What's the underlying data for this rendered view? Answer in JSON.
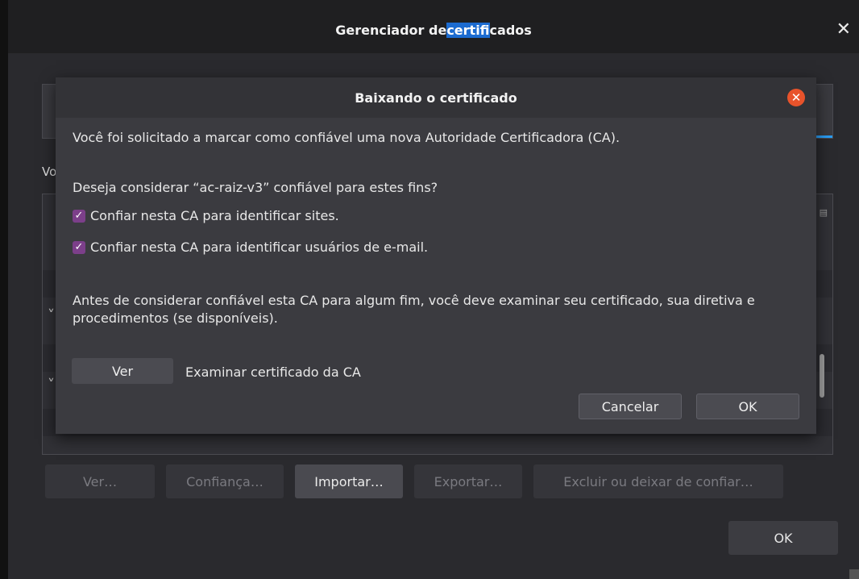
{
  "background_window": {
    "title_prefix": "Gerenciador de ",
    "title_highlight": "certifi",
    "title_suffix": "cados",
    "close_glyph": "✕",
    "list_label": "Vo",
    "buttons": [
      {
        "label": "Ver…",
        "enabled": false
      },
      {
        "label": "Confiança…",
        "enabled": false
      },
      {
        "label": "Importar…",
        "enabled": true
      },
      {
        "label": "Exportar…",
        "enabled": false
      },
      {
        "label": "Excluir ou deixar de confiar…",
        "enabled": false
      }
    ],
    "ok_label": "OK"
  },
  "dialog": {
    "title": "Baixando o certificado",
    "close_glyph": "✕",
    "intro": "Você foi solicitado a marcar como confiável uma nova Autoridade Certificadora (CA).",
    "question": "Deseja considerar “ac-raiz-v3” confiável para estes fins?",
    "checkboxes": [
      {
        "label": "Confiar nesta CA para identificar sites.",
        "checked": true
      },
      {
        "label": "Confiar nesta CA para identificar usuários de e-mail.",
        "checked": true
      }
    ],
    "warning": "Antes de considerar confiável esta CA para algum fim, você deve examinar seu certificado, sua diretiva e procedimentos (se disponíveis).",
    "view_button": "Ver",
    "view_description": "Examinar certificado da CA",
    "cancel_button": "Cancelar",
    "ok_button": "OK"
  },
  "colors": {
    "accent_close": "#e8532b",
    "checkbox": "#7c3f8a",
    "highlight": "#1c6bd0"
  }
}
